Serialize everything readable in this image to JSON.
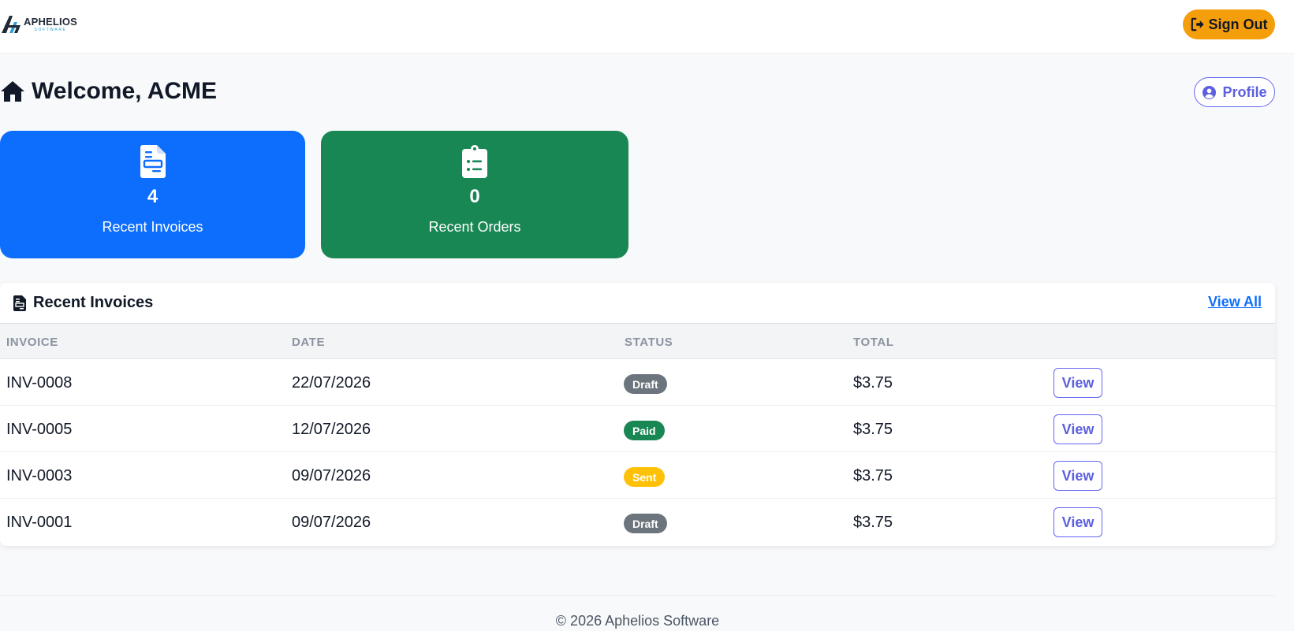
{
  "header": {
    "logo": {
      "name": "APHELIOS",
      "sub": "SOFTWARE"
    },
    "signout_label": "Sign Out"
  },
  "welcome": {
    "title": "Welcome, ACME",
    "profile_label": "Profile"
  },
  "stats": [
    {
      "value": "4",
      "label": "Recent Invoices",
      "color": "#0d6efd",
      "icon": "file-invoice-icon"
    },
    {
      "value": "0",
      "label": "Recent Orders",
      "color": "#198754",
      "icon": "clipboard-list-icon"
    }
  ],
  "invoices": {
    "title": "Recent Invoices",
    "view_all_label": "View All",
    "columns": [
      "INVOICE",
      "DATE",
      "STATUS",
      "TOTAL"
    ],
    "rows": [
      {
        "invoice": "INV-0008",
        "date": "22/07/2026",
        "status": "Draft",
        "total": "$3.75",
        "action": "View"
      },
      {
        "invoice": "INV-0005",
        "date": "12/07/2026",
        "status": "Paid",
        "total": "$3.75",
        "action": "View"
      },
      {
        "invoice": "INV-0003",
        "date": "09/07/2026",
        "status": "Sent",
        "total": "$3.75",
        "action": "View"
      },
      {
        "invoice": "INV-0001",
        "date": "09/07/2026",
        "status": "Draft",
        "total": "$3.75",
        "action": "View"
      }
    ]
  },
  "colors": {
    "accent": "#f59e0b",
    "primary": "#0d6efd",
    "success": "#198754",
    "indigo": "#6366f1",
    "draft": "#6c757d",
    "sent": "#ffc107"
  },
  "footer": {
    "text": "© 2026 Aphelios Software"
  }
}
